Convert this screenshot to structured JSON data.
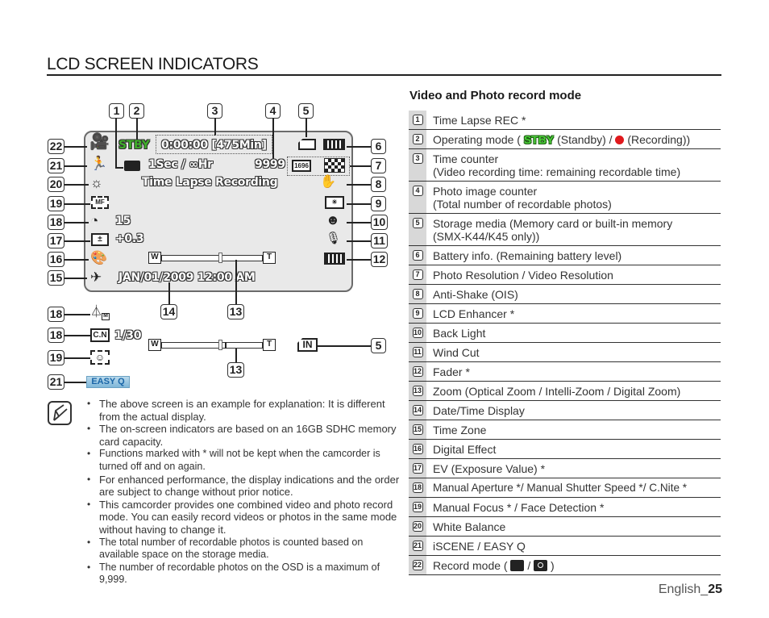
{
  "page": {
    "title": "LCD SCREEN INDICATORS",
    "footer_language": "English_",
    "footer_page": "25"
  },
  "lcd": {
    "status": "STBY",
    "time_counter": "0:00:00 [475Min]",
    "time_lapse": "1Sec / ∞Hr",
    "photo_count": "9999",
    "resolution_label": "1696",
    "mode_banner": "Time Lapse Recording",
    "shutter_value": "15",
    "ev_value": "+0.3",
    "datetime": "JAN/01/2009 12:00 AM",
    "zoom_wide": "W",
    "zoom_tele": "T",
    "cnite_value": "1/30",
    "easy_q": "EASY Q",
    "storage_internal": "IN",
    "aperture_mode": "M",
    "cnite_label": "C.N",
    "manual_focus": "MF"
  },
  "callouts": {
    "c1": "1",
    "c2": "2",
    "c3": "3",
    "c4": "4",
    "c5": "5",
    "c6": "6",
    "c7": "7",
    "c8": "8",
    "c9": "9",
    "c10": "10",
    "c11": "11",
    "c12": "12",
    "c13": "13",
    "c14": "14",
    "c15": "15",
    "c16": "16",
    "c17": "17",
    "c18": "18",
    "c19": "19",
    "c20": "20",
    "c21": "21",
    "c22": "22"
  },
  "notes": [
    "The above screen is an example for explanation: It is different from the actual display.",
    "The on-screen indicators are based on an 16GB SDHC memory card capacity.",
    "Functions marked with * will not be kept when the camcorder is turned off and on again.",
    "For enhanced performance, the display indications and the order are subject to change without prior notice.",
    "This camcorder provides one combined video and photo record mode. You can easily record videos or photos in the same mode without having to change it.",
    "The total number of recordable photos is counted based on available space on the storage media.",
    "The number of recordable photos on the OSD is a maximum of 9,999."
  ],
  "table": {
    "title": "Video and Photo record mode",
    "rows": [
      {
        "num": "1",
        "text": "Time Lapse REC *"
      },
      {
        "num": "2",
        "text_pre": "Operating mode (",
        "stby": "STBY",
        "text_mid": "(Standby) /",
        "text_post": "(Recording))"
      },
      {
        "num": "3",
        "line1": "Time counter",
        "line2": "(Video recording time: remaining recordable time)"
      },
      {
        "num": "4",
        "line1": "Photo image counter",
        "line2": "(Total number of recordable photos)"
      },
      {
        "num": "5",
        "line1": "Storage media (Memory card or built-in memory",
        "line2": "(SMX-K44/K45 only))"
      },
      {
        "num": "6",
        "text": "Battery info. (Remaining battery level)"
      },
      {
        "num": "7",
        "text": "Photo Resolution / Video Resolution"
      },
      {
        "num": "8",
        "text": "Anti-Shake (OIS)"
      },
      {
        "num": "9",
        "text": "LCD Enhancer *"
      },
      {
        "num": "10",
        "text": "Back Light"
      },
      {
        "num": "11",
        "text": "Wind Cut"
      },
      {
        "num": "12",
        "text": "Fader *"
      },
      {
        "num": "13",
        "text": "Zoom (Optical Zoom / Intelli-Zoom / Digital Zoom)"
      },
      {
        "num": "14",
        "text": "Date/Time Display"
      },
      {
        "num": "15",
        "text": "Time Zone"
      },
      {
        "num": "16",
        "text": "Digital Effect"
      },
      {
        "num": "17",
        "text": "EV (Exposure Value) *"
      },
      {
        "num": "18",
        "text": "Manual Aperture */ Manual Shutter Speed */ C.Nite *"
      },
      {
        "num": "19",
        "text": "Manual Focus * / Face Detection *"
      },
      {
        "num": "20",
        "text": "White Balance"
      },
      {
        "num": "21",
        "text": "iSCENE / EASY Q"
      },
      {
        "num": "22",
        "text_pre": "Record mode (",
        "text_mid": "/",
        "text_post": ")"
      }
    ]
  },
  "colors": {
    "stby_green": "#3fae2a",
    "recording_red": "#e0191d",
    "easyq_blue": "#1a66a8",
    "lcd_bg": "#e9e9e9"
  },
  "icons": {
    "record_mode": "video-camera-icon",
    "iscene": "running-person-icon",
    "white_balance": "sun-icon",
    "manual_focus": "mf-focus-icon",
    "shutter": "manual-shutter-icon",
    "ev": "exposure-icon",
    "digital_effect": "palette-icon",
    "time_zone": "airplane-clock-icon",
    "storage_card": "memory-card-icon",
    "battery": "battery-icon",
    "resolution": "resolution-icon",
    "anti_shake": "hand-shake-icon",
    "lcd_enhancer": "lcd-enhancer-icon",
    "back_light": "backlight-icon",
    "wind_cut": "wind-cut-icon",
    "fader": "fader-icon",
    "face_detection": "face-detection-icon"
  }
}
